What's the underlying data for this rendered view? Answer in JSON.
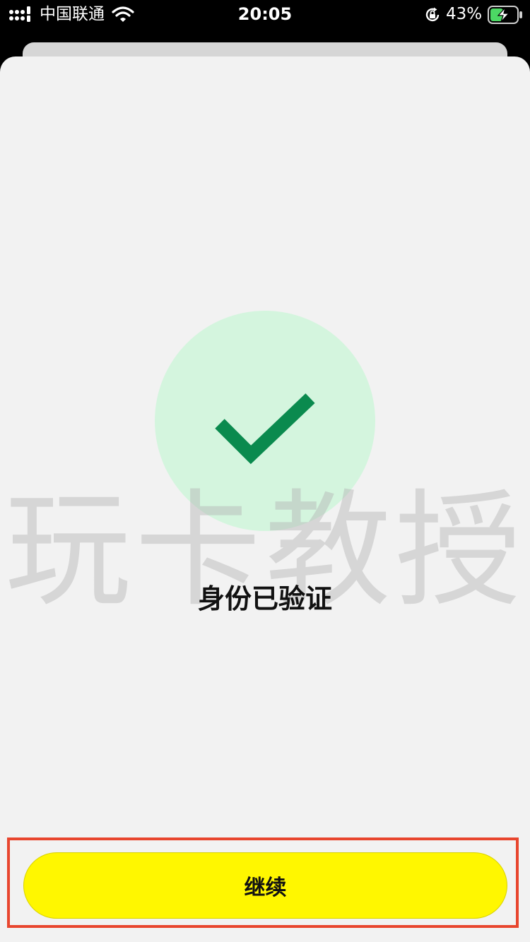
{
  "status_bar": {
    "carrier": "中国联通",
    "time": "20:05",
    "battery_percent": "43%",
    "icons": [
      "signal-icon",
      "wifi-icon",
      "rotation-lock-icon",
      "battery-charging-icon"
    ]
  },
  "verification": {
    "title": "身份已验证",
    "icon": "checkmark-icon"
  },
  "watermark": {
    "text": "玩卡教授"
  },
  "actions": {
    "continue_label": "继续"
  },
  "colors": {
    "accent_button": "#fff700",
    "success_circle": "#d4f5de",
    "check": "#0a8a4e",
    "highlight_border": "#e8462e",
    "sheet_background": "#f2f2f2",
    "battery_charging": "#4cd964"
  }
}
